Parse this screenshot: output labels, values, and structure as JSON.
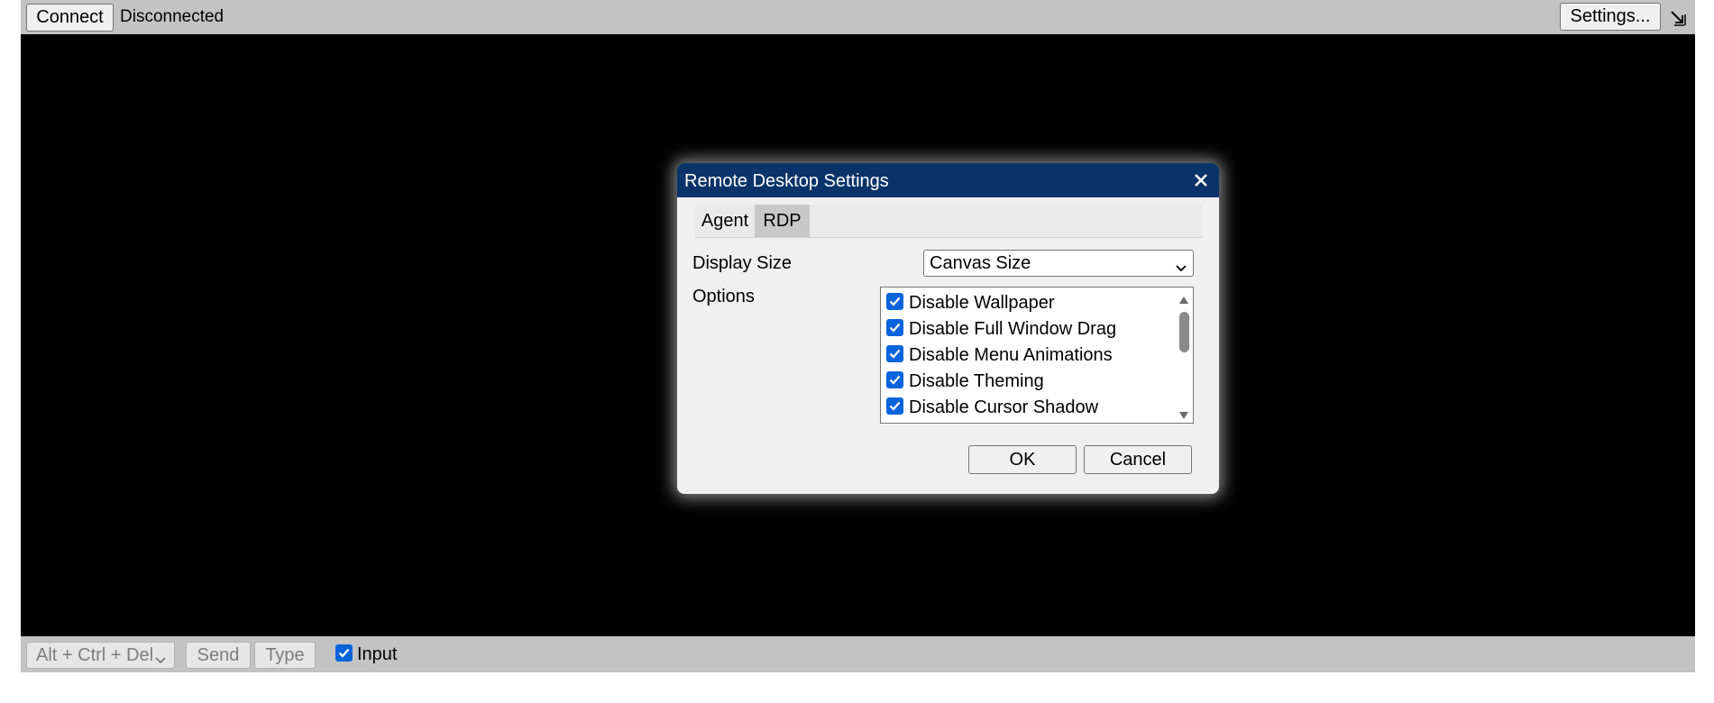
{
  "topbar": {
    "connect_label": "Connect",
    "status": "Disconnected",
    "settings_label": "Settings..."
  },
  "bottombar": {
    "keys_selected": "Alt + Ctrl + Del",
    "send_label": "Send",
    "type_label": "Type",
    "input_label": "Input",
    "input_checked": true
  },
  "dialog": {
    "title": "Remote Desktop Settings",
    "tabs": [
      {
        "label": "Agent",
        "active": false
      },
      {
        "label": "RDP",
        "active": true
      }
    ],
    "display_size_label": "Display Size",
    "display_size_value": "Canvas Size",
    "options_label": "Options",
    "options": [
      {
        "label": "Disable Wallpaper",
        "checked": true
      },
      {
        "label": "Disable Full Window Drag",
        "checked": true
      },
      {
        "label": "Disable Menu Animations",
        "checked": true
      },
      {
        "label": "Disable Theming",
        "checked": true
      },
      {
        "label": "Disable Cursor Shadow",
        "checked": true
      }
    ],
    "ok_label": "OK",
    "cancel_label": "Cancel"
  },
  "colors": {
    "title_bar": "#0a3369",
    "toolbar_bg": "#c3c3c3",
    "checkbox_blue": "#0a64dc",
    "screen_bg": "#000000"
  }
}
